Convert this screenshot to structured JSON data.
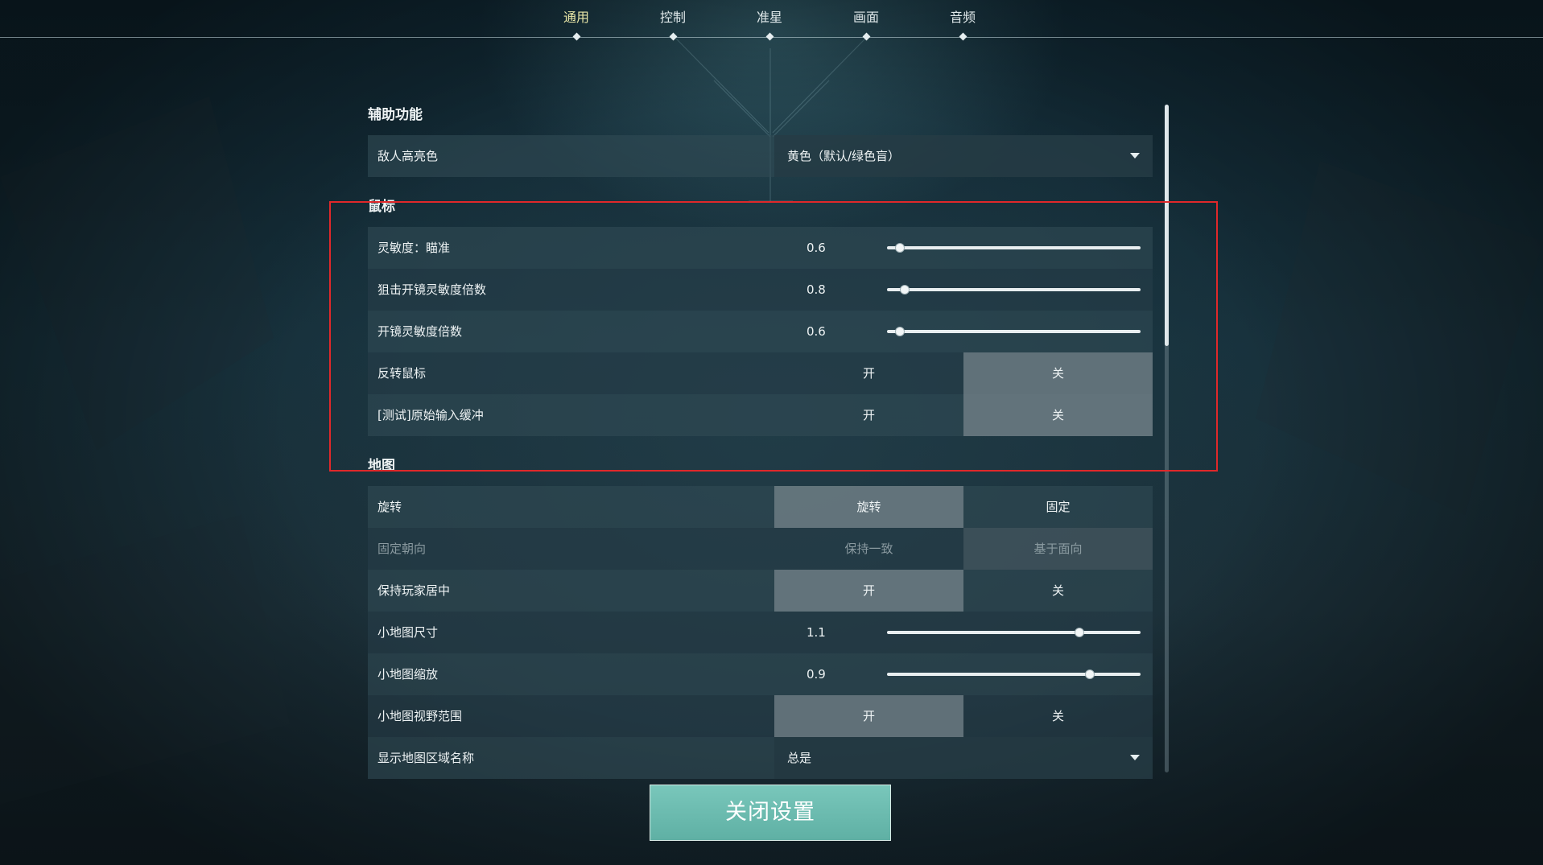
{
  "nav": {
    "tabs": [
      {
        "label": "通用",
        "active": true
      },
      {
        "label": "控制",
        "active": false
      },
      {
        "label": "准星",
        "active": false
      },
      {
        "label": "画面",
        "active": false
      },
      {
        "label": "音频",
        "active": false
      }
    ]
  },
  "sections": {
    "assist": {
      "title": "辅助功能",
      "enemy_highlight": {
        "label": "敌人高亮色",
        "value": "黄色（默认/绿色盲）"
      }
    },
    "mouse": {
      "title": "鼠标",
      "aim_sensitivity": {
        "label": "灵敏度：瞄准",
        "value": "0.6",
        "fraction": 0.05
      },
      "sniper_scope_multiplier": {
        "label": "狙击开镜灵敏度倍数",
        "value": "0.8",
        "fraction": 0.07
      },
      "scope_multiplier": {
        "label": "开镜灵敏度倍数",
        "value": "0.6",
        "fraction": 0.05
      },
      "invert_mouse": {
        "label": "反转鼠标",
        "on": "开",
        "off": "关",
        "selected": "off"
      },
      "raw_input_buffer": {
        "label": "[测试]原始输入缓冲",
        "on": "开",
        "off": "关",
        "selected": "off"
      }
    },
    "map": {
      "title": "地图",
      "rotate": {
        "label": "旋转",
        "opt1": "旋转",
        "opt2": "固定",
        "selected": "opt1"
      },
      "fixed_orientation": {
        "label": "固定朝向",
        "opt1": "保持一致",
        "opt2": "基于面向",
        "selected": "opt2"
      },
      "keep_player_centered": {
        "label": "保持玩家居中",
        "on": "开",
        "off": "关",
        "selected": "on"
      },
      "minimap_size": {
        "label": "小地图尺寸",
        "value": "1.1",
        "fraction": 0.76
      },
      "minimap_zoom": {
        "label": "小地图缩放",
        "value": "0.9",
        "fraction": 0.8
      },
      "minimap_vision_cones": {
        "label": "小地图视野范围",
        "on": "开",
        "off": "关",
        "selected": "on"
      },
      "show_region_names": {
        "label": "显示地图区域名称",
        "value": "总是"
      }
    }
  },
  "scroll": {
    "fraction": 0.36
  },
  "footer": {
    "close_label": "关闭设置"
  }
}
